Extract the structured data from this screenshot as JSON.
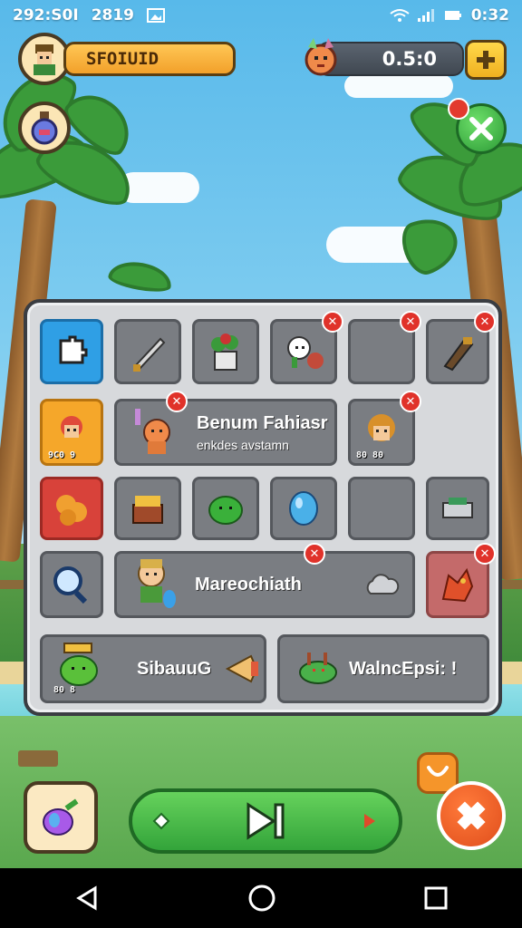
{
  "status_bar": {
    "time_left": "292:S0I",
    "time_mid": "2819",
    "time_right": "0:32"
  },
  "player": {
    "name": "SFOIUID"
  },
  "timer": {
    "value": "0.5:0"
  },
  "inventory": {
    "wide_items": [
      {
        "title": "Benum Fahiasr",
        "subtitle": "enkdes avstamn"
      },
      {
        "title": "Mareochiath"
      },
      {
        "title": "SibauuG"
      },
      {
        "title": "WalncEpsi: !"
      }
    ],
    "slot_labels": {
      "hero_tag": "9C0 9",
      "girl_tag": "80 80",
      "frog_tag": "80 8"
    }
  },
  "colors": {
    "accent": "#f2a02a",
    "panel": "#d7d9dc",
    "play": "#33a43a",
    "badge": "#e0322a"
  },
  "icons": [
    "avatar-icon",
    "potion-icon",
    "close-icon",
    "plus-icon",
    "pet-icon",
    "bag-icon",
    "play-icon",
    "action-icon",
    "back-icon",
    "home-icon",
    "recents-icon"
  ]
}
